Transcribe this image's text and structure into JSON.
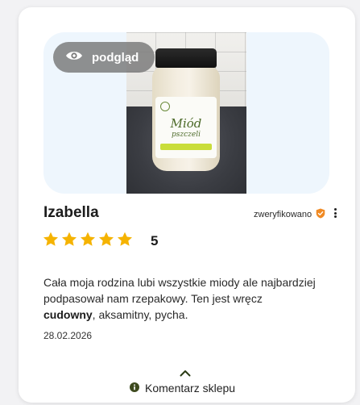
{
  "review": {
    "preview_label": "podgląd",
    "author": "Izabella",
    "verified_label": "zweryfikowano",
    "rating": 5,
    "rating_label": "5",
    "text_before": "Cała moja rodzina lubi wszystkie miody ale najbardziej podpasował nam rzepakowy. Ten jest wręcz ",
    "text_bold": "cudowny",
    "text_after": ", aksamitny, pycha.",
    "date": "28.02.2026",
    "shop_comment_label": "Komentarz sklepu",
    "jar_label_title": "Miód",
    "jar_label_subtitle": "pszczeli"
  },
  "colors": {
    "star": "#f5b301",
    "verified_badge": "#f08a24",
    "info_icon": "#3d4a1e",
    "media_bg": "#eef6fd"
  },
  "icons": {
    "preview": "eye-icon",
    "verified": "shield-check-icon",
    "menu": "kebab-menu-icon",
    "expand": "chevron-up-icon",
    "info": "info-icon"
  }
}
